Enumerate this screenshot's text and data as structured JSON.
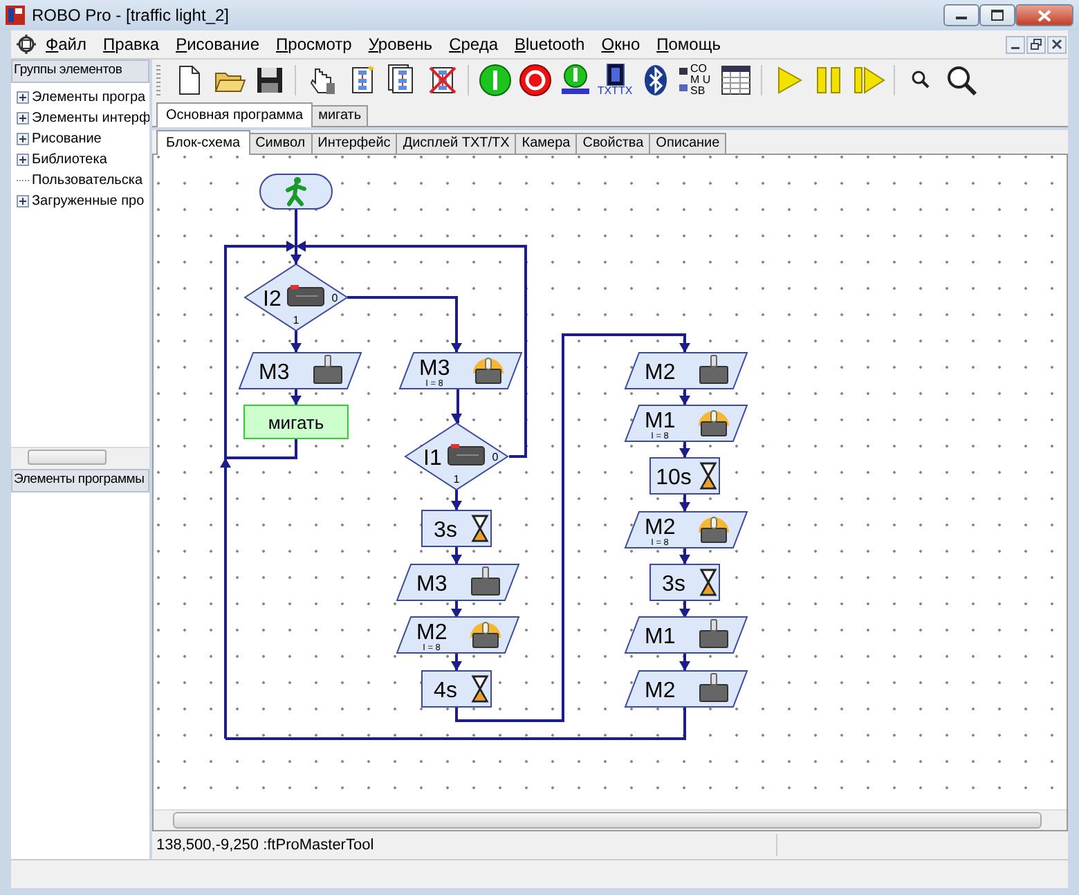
{
  "window": {
    "title": "ROBO Pro - [traffic light_2]"
  },
  "menu": [
    "Файл",
    "Правка",
    "Рисование",
    "Просмотр",
    "Уровень",
    "Среда",
    "Bluetooth",
    "Окно",
    "Помощь"
  ],
  "toolbar": [
    {
      "kind": "new"
    },
    {
      "kind": "open"
    },
    {
      "kind": "save"
    },
    {
      "kind": "separator"
    },
    {
      "kind": "hand"
    },
    {
      "kind": "new-subprogram"
    },
    {
      "kind": "copy-subprogram"
    },
    {
      "kind": "delete-subprogram"
    },
    {
      "kind": "separator"
    },
    {
      "kind": "start"
    },
    {
      "kind": "stop"
    },
    {
      "kind": "download"
    },
    {
      "kind": "interface",
      "label": "TXTTX"
    },
    {
      "kind": "bluetooth"
    },
    {
      "kind": "port",
      "label": "COM USB"
    },
    {
      "kind": "panel"
    },
    {
      "kind": "separator"
    },
    {
      "kind": "run"
    },
    {
      "kind": "pause"
    },
    {
      "kind": "step"
    },
    {
      "kind": "separator"
    },
    {
      "kind": "zoom-out"
    },
    {
      "kind": "zoom-in"
    }
  ],
  "sidebar": {
    "title": "Группы элементов",
    "items": [
      {
        "label": "Элементы програ",
        "kind": "folder",
        "expanded": false
      },
      {
        "label": "Элементы интерф",
        "kind": "folder",
        "expanded": false
      },
      {
        "label": "Рисование",
        "kind": "folder",
        "expanded": false
      },
      {
        "label": "Библиотека",
        "kind": "folder",
        "expanded": false
      },
      {
        "label": "Пользовательска",
        "kind": "leaf"
      },
      {
        "label": "Загруженные про",
        "kind": "folder",
        "expanded": false
      }
    ],
    "lower_title": "Элементы программы"
  },
  "program_tabs": [
    {
      "label": "Основная программа",
      "selected": true
    },
    {
      "label": "мигать",
      "selected": false
    }
  ],
  "view_tabs": [
    {
      "label": "Блок-схема",
      "selected": true
    },
    {
      "label": "Символ",
      "selected": false
    },
    {
      "label": "Интерфейс",
      "selected": false
    },
    {
      "label": "Дисплей TXT/TX",
      "selected": false
    },
    {
      "label": "Камера",
      "selected": false
    },
    {
      "label": "Свойства",
      "selected": false
    },
    {
      "label": "Описание",
      "selected": false
    }
  ],
  "flowchart": {
    "nodes": [
      {
        "kind": "start"
      },
      {
        "kind": "decision",
        "label": "I2",
        "no_label": "0",
        "yes_label": "1"
      },
      {
        "kind": "motor",
        "label": "M3"
      },
      {
        "kind": "subprogram",
        "label": "мигать"
      },
      {
        "kind": "lamp",
        "label": "M3",
        "value": "I = 8"
      },
      {
        "kind": "decision",
        "label": "I1",
        "no_label": "0",
        "yes_label": "1"
      },
      {
        "kind": "wait",
        "label": "3s"
      },
      {
        "kind": "motor",
        "label": "M3"
      },
      {
        "kind": "lamp",
        "label": "M2",
        "value": "I = 8"
      },
      {
        "kind": "wait",
        "label": "4s"
      },
      {
        "kind": "motor",
        "label": "M2"
      },
      {
        "kind": "lamp",
        "label": "M1",
        "value": "I = 8"
      },
      {
        "kind": "wait",
        "label": "10s"
      },
      {
        "kind": "lamp",
        "label": "M2",
        "value": "I = 8"
      },
      {
        "kind": "wait",
        "label": "3s"
      },
      {
        "kind": "motor",
        "label": "M1"
      },
      {
        "kind": "motor",
        "label": "M2"
      }
    ]
  },
  "status_bar": {
    "text": "138,500,-9,250 :ftProMasterTool"
  }
}
